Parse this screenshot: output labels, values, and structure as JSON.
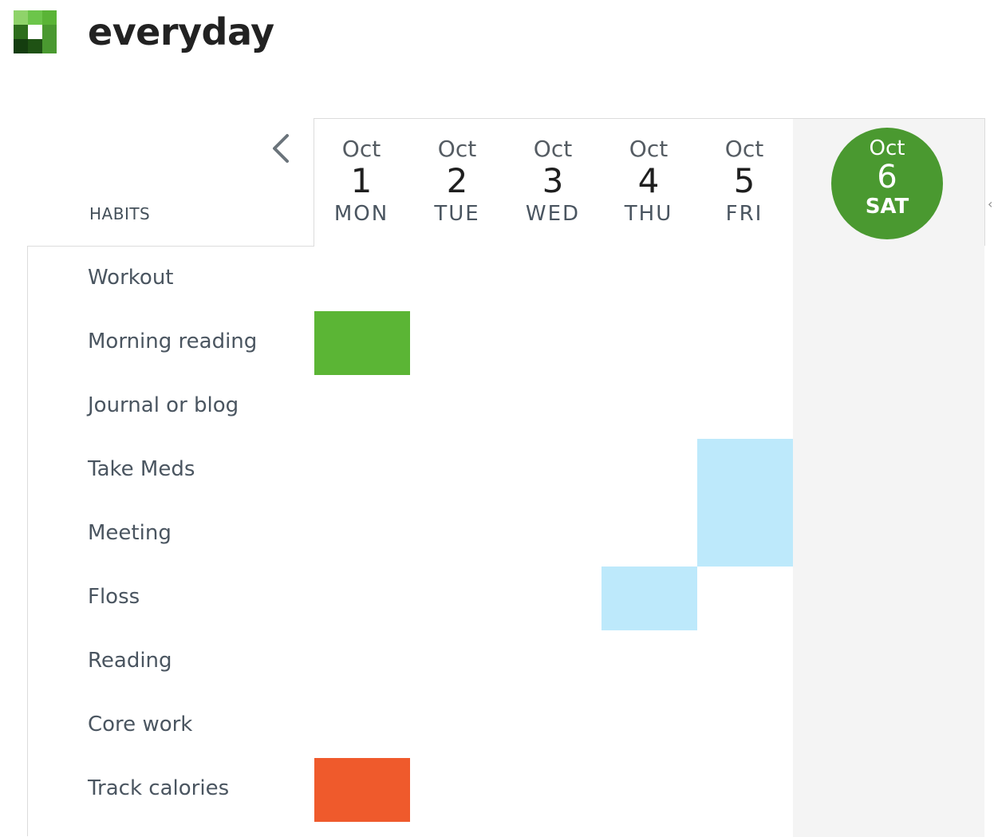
{
  "app": {
    "title": "everyday",
    "logo_colors": [
      "#8fd36a",
      "#6cc54a",
      "#5ab436",
      "#2d6e1c",
      "#ffffff",
      "#4a9930",
      "#143d0f",
      "#1f5214",
      "#4a9930"
    ]
  },
  "habits_heading": "HABITS",
  "nav": {
    "prev_icon": "chevron-left-icon",
    "next_icon": "chevron-right-icon"
  },
  "days": [
    {
      "month": "Oct",
      "day": "1",
      "weekday": "MON"
    },
    {
      "month": "Oct",
      "day": "2",
      "weekday": "TUE"
    },
    {
      "month": "Oct",
      "day": "3",
      "weekday": "WED"
    },
    {
      "month": "Oct",
      "day": "4",
      "weekday": "THU"
    },
    {
      "month": "Oct",
      "day": "5",
      "weekday": "FRI"
    }
  ],
  "today": {
    "month": "Oct",
    "day": "6",
    "weekday": "SAT",
    "color": "#4a9930"
  },
  "habits": [
    "Workout",
    "Morning reading",
    "Journal or blog",
    "Take Meds",
    "Meeting",
    "Floss",
    "Reading",
    "Core work",
    "Track calories"
  ],
  "colors": {
    "done_green": "#5bb535",
    "done_blue": "#bde9fb",
    "done_orange": "#ef5a2c",
    "today_bg": "#f4f4f4"
  },
  "marked_cells": [
    {
      "habit": "Morning reading",
      "day": "MON",
      "color": "#5bb535"
    },
    {
      "habit": "Take Meds",
      "day": "FRI",
      "color": "#bde9fb"
    },
    {
      "habit": "Meeting",
      "day": "FRI",
      "color": "#bde9fb"
    },
    {
      "habit": "Floss",
      "day": "THU",
      "color": "#bde9fb"
    },
    {
      "habit": "Track calories",
      "day": "MON",
      "color": "#ef5a2c"
    }
  ]
}
